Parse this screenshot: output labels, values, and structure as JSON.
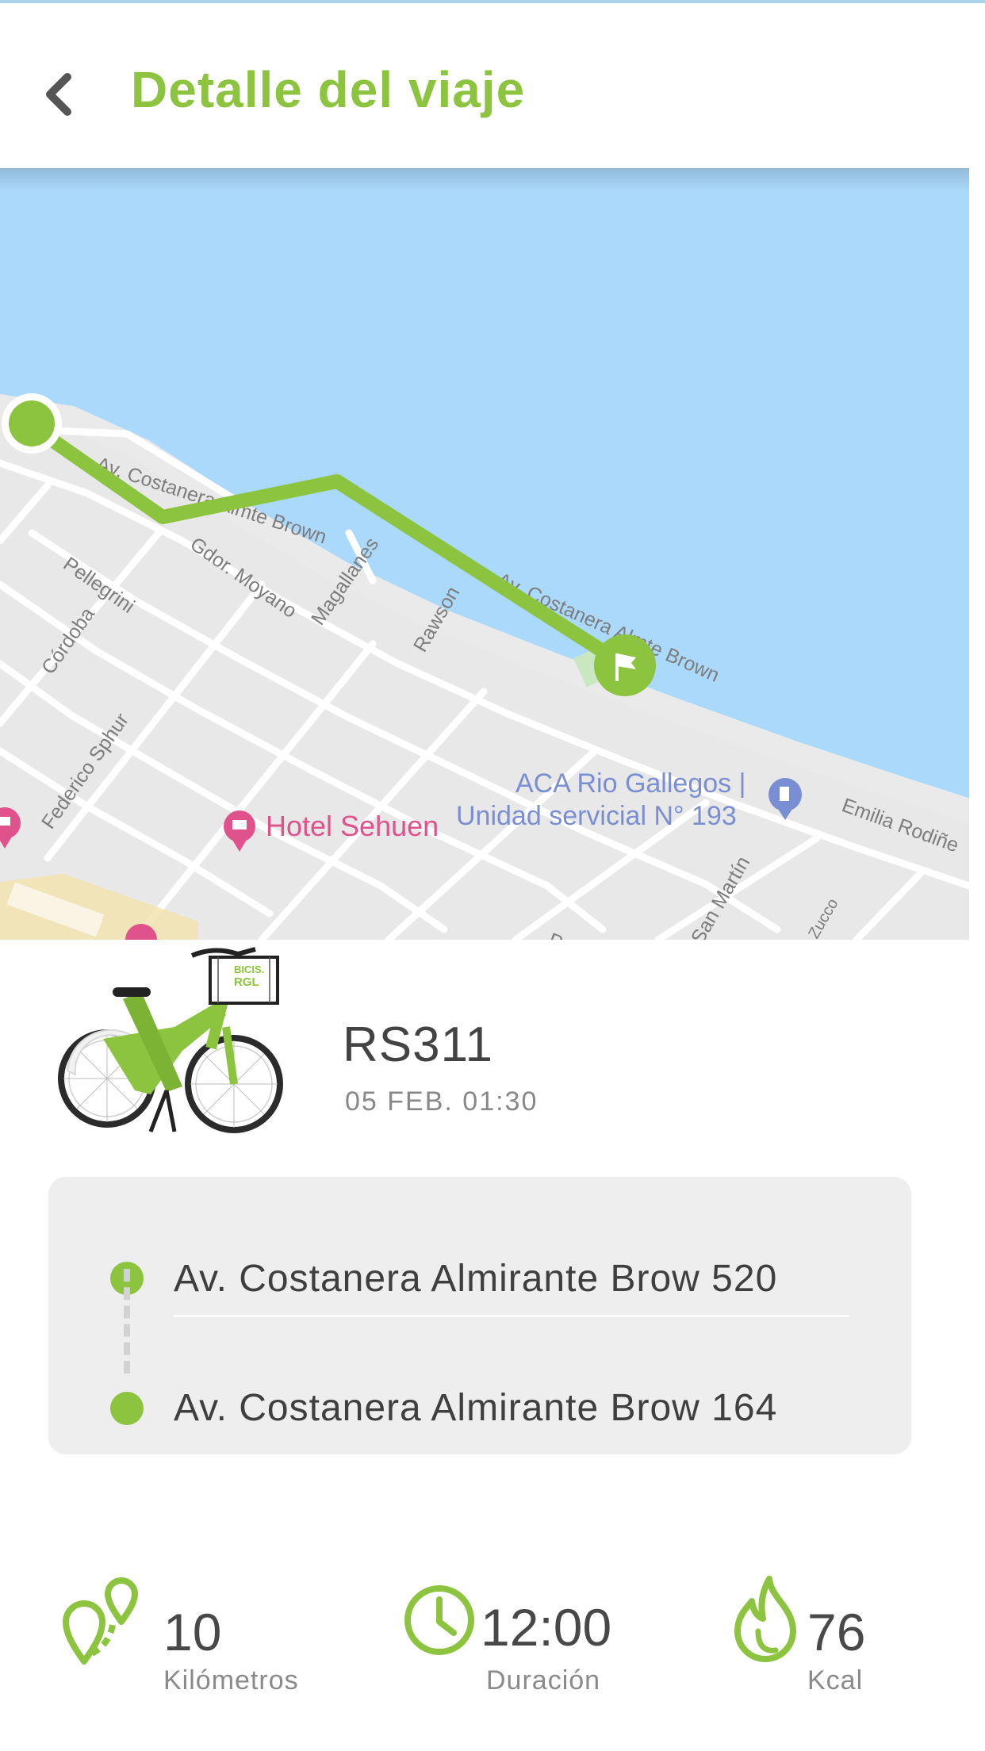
{
  "header": {
    "back_icon": "chevron-left-icon",
    "title": "Detalle del viaje"
  },
  "colors": {
    "accent": "#8cc43f",
    "water": "#aad9fb",
    "land": "#e8e8e8",
    "poi_pink": "#e0528b",
    "poi_blue": "#7a8ed3"
  },
  "map": {
    "streets": {
      "costanera_a": "Av. Costanera Almte Brown",
      "costanera_b": "Av. Costanera Almte Brown",
      "pellegrini": "Pellegrini",
      "cordoba": "Córdoba",
      "moyano": "Gdor. Moyano",
      "magallanes": "Magallanes",
      "rawson": "Rawson",
      "federico": "Federico Sphur",
      "emilia": "Emilia Rodiñe",
      "sanmartin": "San Martín",
      "pell": "Pell",
      "zucco": "Zucco"
    },
    "poi_hotel": "Hotel Sehuen",
    "poi_aca_line1": "ACA Rio Gallegos |",
    "poi_aca_line2": "Unidad servicial N° 193",
    "start_marker": "start-marker",
    "end_marker": "flag-icon"
  },
  "trip": {
    "bike_image": "bike-image",
    "bike_logo_line1": "BICIS.",
    "bike_logo_line2": "RGL",
    "bike_id": "RS311",
    "datetime": "05 FEB. 01:30"
  },
  "route": {
    "origin": "Av. Costanera Almirante Brow 520",
    "destination": "Av. Costanera Almirante Brow 164"
  },
  "stats": [
    {
      "icon": "route-pins-icon",
      "value": "10",
      "label": "Kilómetros"
    },
    {
      "icon": "clock-icon",
      "value": "12:00",
      "label": "Duración"
    },
    {
      "icon": "flame-icon",
      "value": "76",
      "label": "Kcal"
    }
  ]
}
